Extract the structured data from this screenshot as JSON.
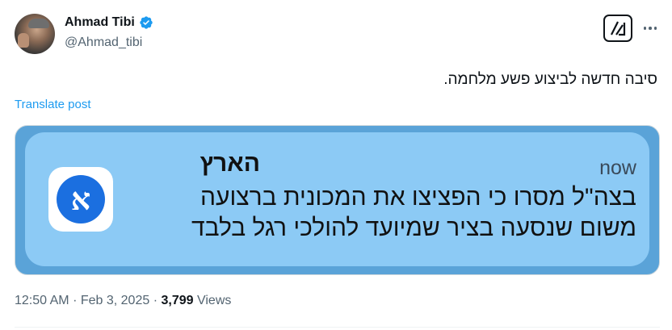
{
  "author": {
    "name": "Ahmad Tibi",
    "handle": "@Ahmad_tibi"
  },
  "tweet": {
    "text": "סיבה חדשה לביצוע פשע מלחמה.",
    "translate_label": "Translate post"
  },
  "notification": {
    "app_letter": "א",
    "title": "הארץ",
    "time": "now",
    "line1": "בצה\"ל מסרו כי הפציצו את המכונית ברצועה",
    "line2": "משום שנסעה בציר שמיועד להולכי רגל בלבד"
  },
  "meta": {
    "time": "12:50 AM",
    "separator": "·",
    "date": "Feb 3, 2025",
    "views_count": "3,799",
    "views_label": "Views"
  },
  "colors": {
    "accent": "#1d9bf0",
    "media_frame": "#5aa3d8",
    "notification_bg": "#8ccaf5",
    "app_icon_blue": "#1b6fe0"
  },
  "icons": {
    "verified": "verified-badge-icon",
    "grok": "grok-icon",
    "more": "more-dots-icon"
  }
}
